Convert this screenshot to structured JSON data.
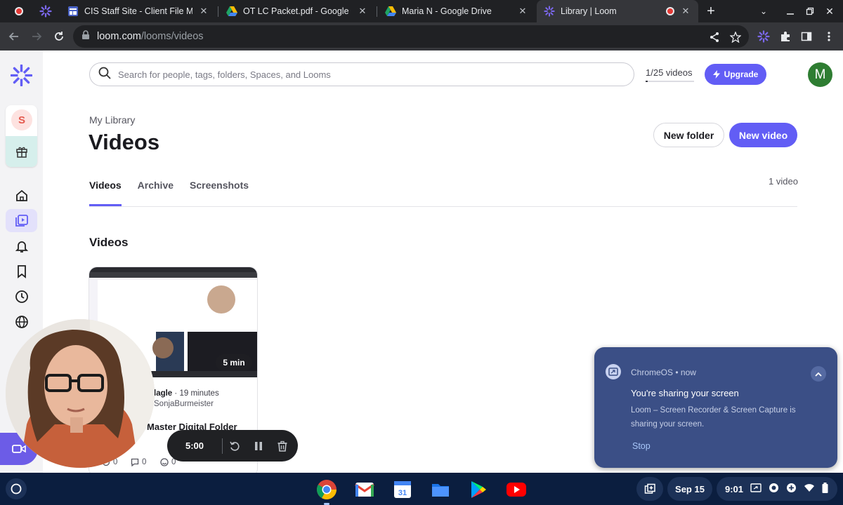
{
  "browser": {
    "tabs": [
      {
        "title": "CIS Staff Site - Client File Materi",
        "favicon": "google-sites-icon"
      },
      {
        "title": "OT LC Packet.pdf - Google Drive",
        "favicon": "google-drive-icon"
      },
      {
        "title": "Maria N - Google Drive",
        "favicon": "google-drive-icon"
      },
      {
        "title": "Library | Loom",
        "favicon": "loom-icon",
        "active": true
      }
    ],
    "url_domain": "loom.com",
    "url_path": "/looms/videos"
  },
  "header": {
    "search_placeholder": "Search for people, tags, folders, Spaces, and Looms",
    "video_count": "1/25 videos",
    "video_count_fraction": 0.04,
    "upgrade_label": "Upgrade",
    "profile_initial": "M"
  },
  "sidebar": {
    "workspace_initial": "S",
    "items": [
      "home-icon",
      "library-icon",
      "bell-icon",
      "bookmark-icon",
      "clock-icon",
      "globe-icon"
    ]
  },
  "page": {
    "breadcrumb": "My Library",
    "title": "Videos",
    "new_folder_label": "New folder",
    "new_video_label": "New video",
    "tabs": [
      {
        "label": "Videos",
        "selected": true
      },
      {
        "label": "Archive"
      },
      {
        "label": "Screenshots"
      }
    ],
    "video_total": "1 video",
    "section_title": "Videos"
  },
  "video_card": {
    "duration": "5 min",
    "owner_partial": "lagle",
    "age": "19 minutes",
    "workspace_partial": "SonjaBurmeister",
    "title_partial": "Master Digital Folder",
    "views": "0",
    "comments": "0",
    "reactions": "0"
  },
  "recording": {
    "time": "5:00"
  },
  "notification": {
    "source": "ChromeOS",
    "when": "now",
    "title": "You're sharing your screen",
    "body": "Loom – Screen Recorder & Screen Capture is sharing your screen.",
    "action": "Stop"
  },
  "shelf": {
    "apps": [
      "chrome-icon",
      "gmail-icon",
      "calendar-icon",
      "files-icon",
      "play-store-icon",
      "youtube-icon"
    ],
    "date": "Sep 15",
    "time": "9:01"
  },
  "colors": {
    "loom_purple": "#625df5",
    "notif_bg": "#3b4f86",
    "shelf_bg": "#0b1e3f"
  }
}
